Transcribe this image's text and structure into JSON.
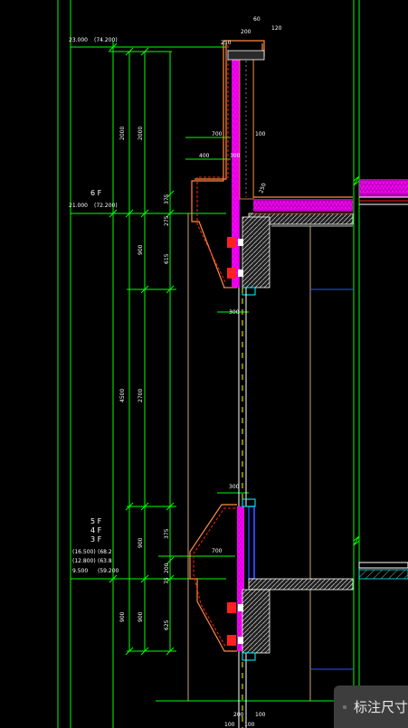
{
  "levels": {
    "top_elev": "23.000",
    "top_elev_paren": "(74.200)",
    "floor6_label": "6 F",
    "floor6_elev": "21.000",
    "floor6_elev_paren": "(72.200)",
    "floor5_label": "5 F",
    "floor4_label": "4 F",
    "floor3_label": "3 F",
    "row1_a": "(16.500)",
    "row1_b": "(68.2",
    "row2_a": "(12.800)",
    "row2_b": "(63.8",
    "row3_a": "9.500",
    "row3_b": "(59.200"
  },
  "dimensions": {
    "top_60": "60",
    "top_200": "200",
    "top_120": "120",
    "top_250": "250",
    "d2000_outer": "2000",
    "d2000_inner": "2000",
    "d700_upper": "700",
    "d100": "100",
    "d400": "400",
    "d300_upper": "300",
    "d375_upper": "375",
    "d275": "275",
    "d615_upper": "615",
    "d900_upper": "900",
    "d300_mid": "300",
    "d4500": "4500",
    "d2700": "2700",
    "d300_lower": "300",
    "d900_mid": "900",
    "d375_lower": "375",
    "d700_lower": "700",
    "d200": "200",
    "d75": "75",
    "d900_outer": "900",
    "d900_inner": "900",
    "d625": "625",
    "bottom_200": "200",
    "bottom_100": "100",
    "bottom_100b": "100",
    "bottom_100c": "100",
    "slab_250": "250"
  },
  "ui": {
    "annotation_button_label": "标注尺寸",
    "annotation_icon": "grid-dots-icon"
  },
  "colors": {
    "background": "#000000",
    "dim_line": "#00ff00",
    "wall_outline": "#ff8c3c",
    "insulation": "#ff00ff",
    "red": "#ff2020",
    "white": "#ffffff",
    "blue": "#2040ff",
    "cyan": "#00ffff",
    "yellow": "#ffff00"
  }
}
